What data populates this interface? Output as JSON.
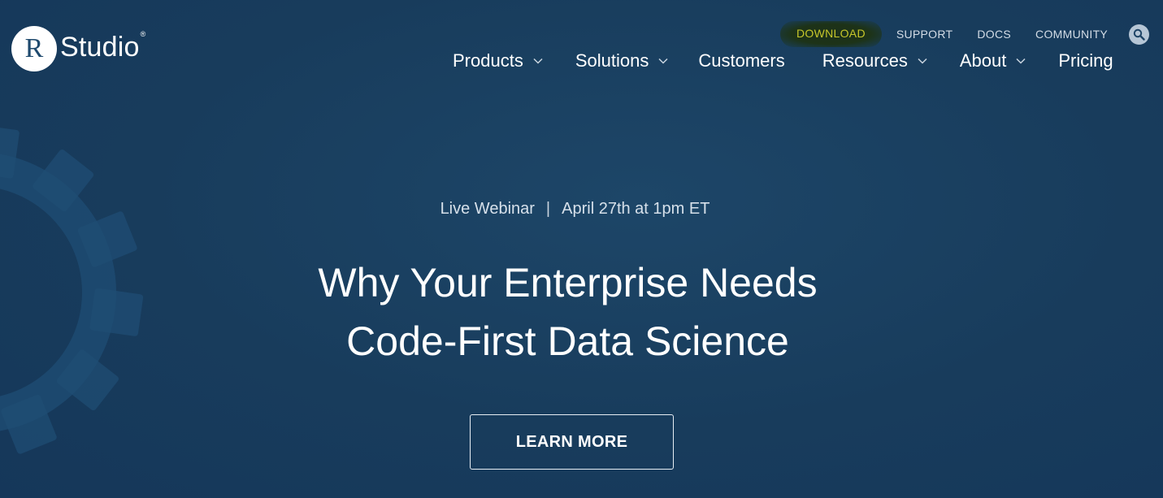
{
  "logo": {
    "mark": "R",
    "text": "Studio",
    "registered": "®"
  },
  "util_nav": {
    "download": "DOWNLOAD",
    "support": "SUPPORT",
    "docs": "DOCS",
    "community": "COMMUNITY",
    "search_icon": "search-icon"
  },
  "main_nav": {
    "products": "Products",
    "solutions": "Solutions",
    "customers": "Customers",
    "resources": "Resources",
    "about": "About",
    "pricing": "Pricing"
  },
  "hero": {
    "eyebrow_left": "Live Webinar",
    "eyebrow_sep": "|",
    "eyebrow_right": "April 27th at 1pm ET",
    "headline_line1": "Why Your Enterprise Needs",
    "headline_line2": "Code-First Data Science",
    "cta": "LEARN MORE"
  },
  "colors": {
    "background": "#183c5c",
    "download_highlight": "#c7c72a",
    "gear": "#21527a"
  }
}
